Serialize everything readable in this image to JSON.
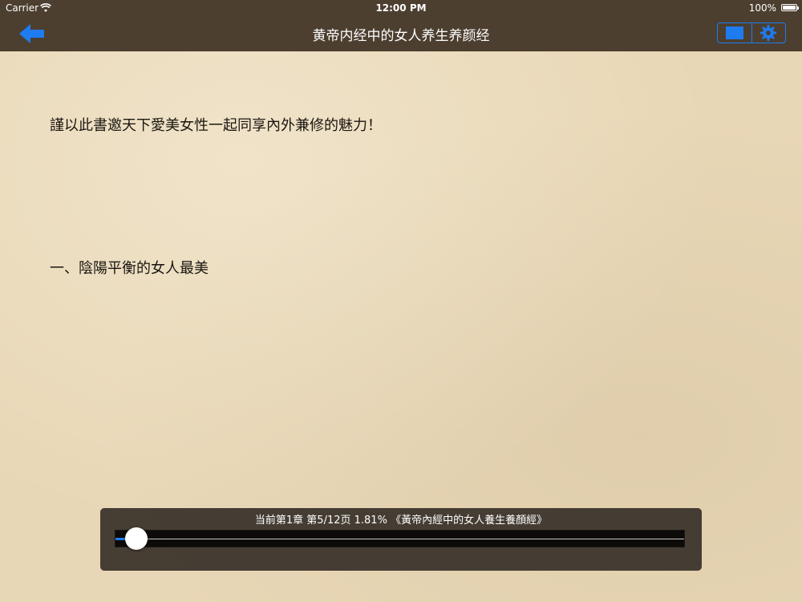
{
  "status_bar": {
    "carrier": "Carrier",
    "time": "12:00 PM",
    "battery": "100%"
  },
  "nav": {
    "title": "黄帝内经中的女人养生养颜经",
    "back_icon": "back-arrow-icon",
    "layout_icon": "layout-square-icon",
    "settings_icon": "gear-icon",
    "accent_color": "#1e7bf0"
  },
  "content": {
    "paragraphs": [
      "謹以此書邀天下愛美女性一起同享內外兼修的魅力！",
      "一、陰陽平衡的女人最美"
    ]
  },
  "progress": {
    "label": "当前第1章 第5/12页 1.81% 《黃帝內經中的女人養生養顏經》",
    "percent": 1.81
  }
}
